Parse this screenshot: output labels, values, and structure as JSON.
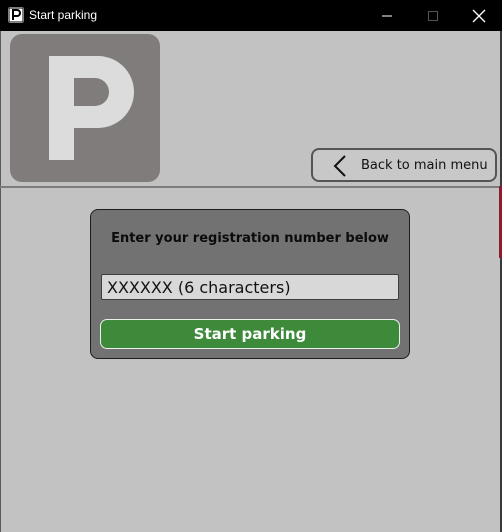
{
  "window": {
    "title": "Start parking",
    "controls": [
      "minimize",
      "maximize",
      "close"
    ]
  },
  "header": {
    "logo_letter": "P",
    "back_button_label": "Back to main menu",
    "back_icon": "chevron-left-icon"
  },
  "form": {
    "heading": "Enter your registration number below",
    "registration_value": "",
    "registration_placeholder": "XXXXXX (6 characters)",
    "submit_label": "Start parking"
  },
  "colors": {
    "background": "#c2c2c2",
    "card": "#727272",
    "logo_tile": "#807c7b",
    "submit_button": "#3d8a3a",
    "accent": "#8c1c2e"
  }
}
